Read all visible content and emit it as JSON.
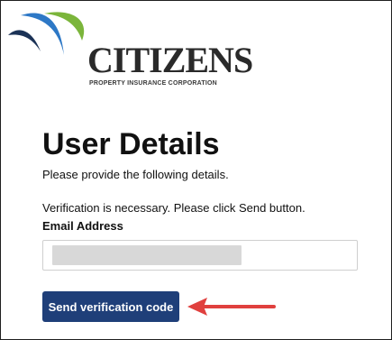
{
  "logo": {
    "name": "CITIZENS",
    "subtitle": "PROPERTY INSURANCE CORPORATION"
  },
  "page": {
    "title": "User Details",
    "intro": "Please provide the following details.",
    "verification_message": "Verification is necessary. Please click Send button."
  },
  "form": {
    "email_label": "Email Address",
    "email_value": "",
    "send_button_label": "Send verification code"
  },
  "colors": {
    "brand_blue": "#1f3f79",
    "swoosh_dark": "#1b3256",
    "swoosh_blue": "#2d78c6",
    "swoosh_green": "#7bb53b",
    "arrow": "#e0403e"
  }
}
